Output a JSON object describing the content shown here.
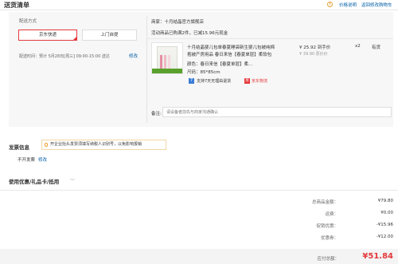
{
  "header": {
    "title": "送货清单",
    "price_note": "价格说明",
    "back_cart": "返回修改购物车"
  },
  "delivery": {
    "label": "配送方式",
    "option_jd": "京东快递",
    "option_door": "上门自提",
    "time_text": "配送时间：预计 5月28日[周三] 09:00-15:00 送达",
    "edit": "修改"
  },
  "store": {
    "name": "商家：十月结晶官方旗舰店",
    "promo": "活动商品已购满2件，已减15.96元现金"
  },
  "product": {
    "name_line1": "十月结晶婴儿包单春夏睡袋新生婴儿包被纯棉",
    "name_line2": "抱被产房用品 春日来信【春夏单层】柔软包",
    "color": "颜色：春日来信【春夏单层】柔...",
    "size": "尺码：85*85cm",
    "price": "¥ 25.92 到手价",
    "price_old": "¥ 39.90 原价价",
    "qty": "x2",
    "stock": "有货",
    "service1": "支持7天无理由退货",
    "service2": "京东物流",
    "service1_icon": "return-icon",
    "service2_icon": "jd-logistics-icon"
  },
  "remark": {
    "label": "备注:",
    "placeholder": "请设备者前先与商家沟通确认"
  },
  "invoice": {
    "title": "发票信息",
    "tip": "开企业抬头发票须填写纳税人识别号，以免影响报销",
    "value": "不开发票",
    "edit": "修改"
  },
  "coupon": {
    "label": "使用优惠/礼品卡/抵用",
    "chevron": "﹀"
  },
  "summary": {
    "rows": [
      {
        "label": "总商品金额：",
        "value": "¥79.80"
      },
      {
        "label": "运费：",
        "value": "¥0.00"
      },
      {
        "label": "促销优惠：",
        "value": "-¥15.96"
      },
      {
        "label": "优惠券：",
        "value": "-¥12.00"
      }
    ],
    "pay_label": "应付总额：",
    "pay_value": "¥51.84"
  },
  "colors": {
    "accent_red": "#e4393c",
    "link_blue": "#005ea7"
  }
}
